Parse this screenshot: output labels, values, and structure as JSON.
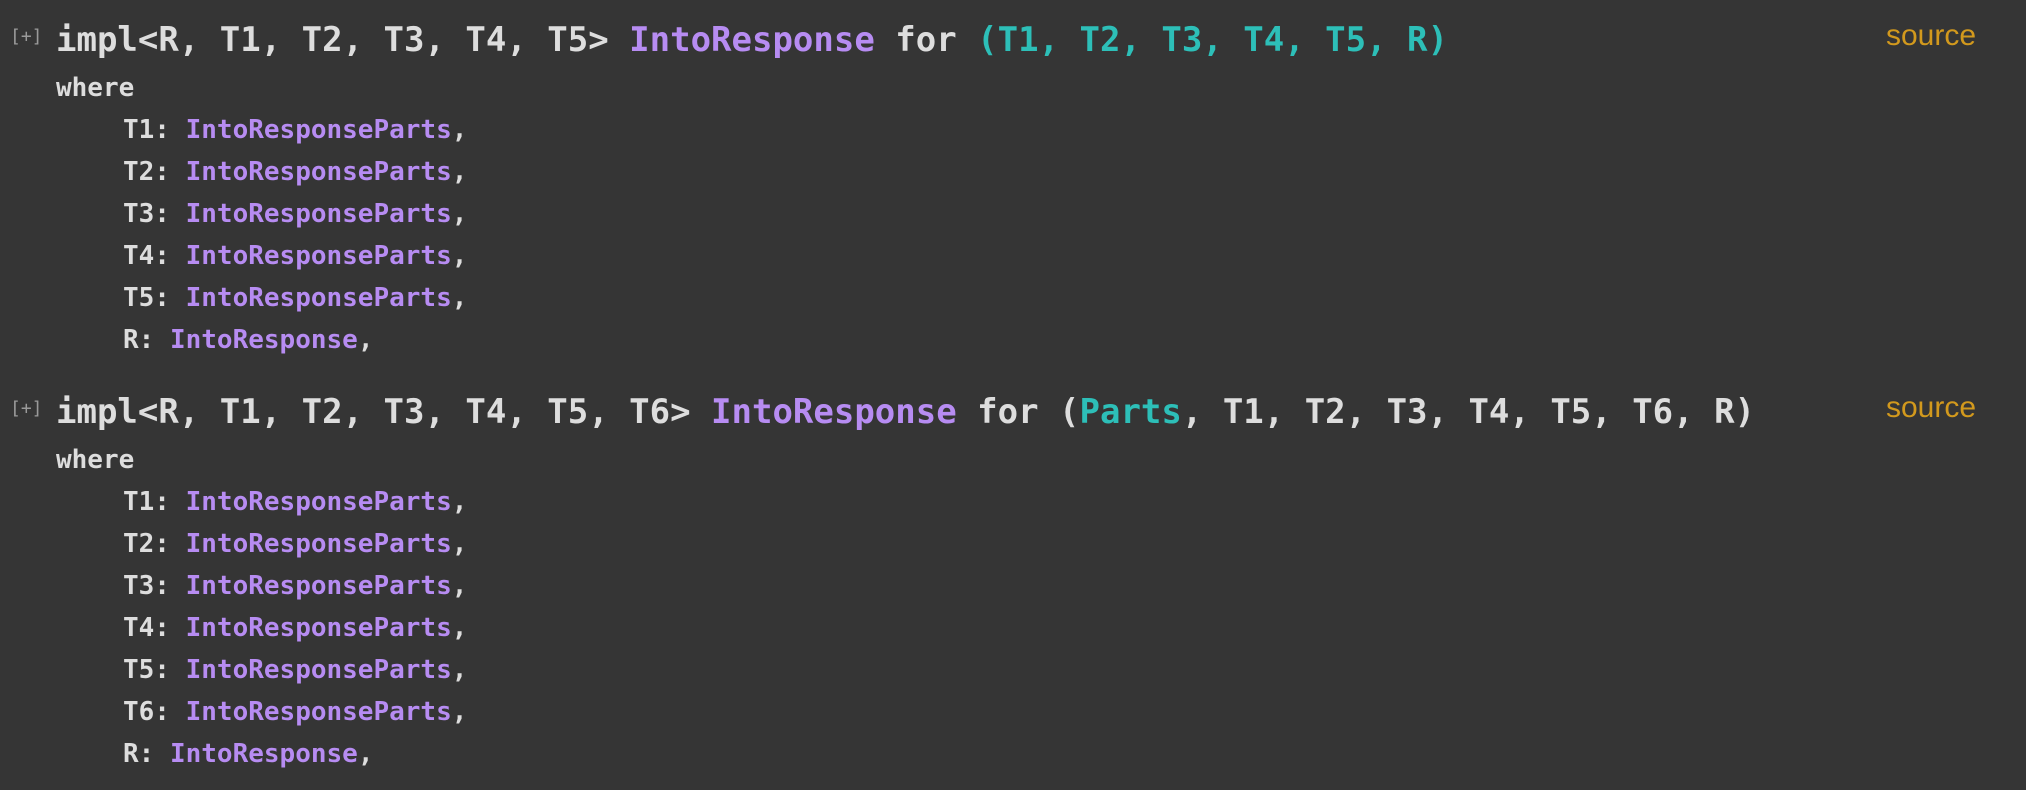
{
  "colors": {
    "background": "#353535",
    "text": "#dddddd",
    "trait": "#b78cf2",
    "type": "#2dbfb8",
    "source_link": "#d2991d"
  },
  "impls": [
    {
      "toggle": "[+]",
      "header_prefix": "impl<R, T1, T2, T3, T4, T5> ",
      "trait_name": "IntoResponse",
      "for_kw": " for ",
      "target": "(T1, T2, T3, T4, T5, R)",
      "source": "source",
      "where_kw": "where",
      "bounds": [
        {
          "param": "T1: ",
          "trait": "IntoResponseParts",
          "punct": ","
        },
        {
          "param": "T2: ",
          "trait": "IntoResponseParts",
          "punct": ","
        },
        {
          "param": "T3: ",
          "trait": "IntoResponseParts",
          "punct": ","
        },
        {
          "param": "T4: ",
          "trait": "IntoResponseParts",
          "punct": ","
        },
        {
          "param": "T5: ",
          "trait": "IntoResponseParts",
          "punct": ","
        },
        {
          "param": "R: ",
          "trait": "IntoResponse",
          "punct": ","
        }
      ]
    },
    {
      "toggle": "[+]",
      "header_prefix": "impl<R, T1, T2, T3, T4, T5, T6> ",
      "trait_name": "IntoResponse",
      "for_kw": " for ",
      "target_open": "(",
      "target_type": "Parts",
      "target_rest": ", T1, T2, T3, T4, T5, T6, R)",
      "source": "source",
      "where_kw": "where",
      "bounds": [
        {
          "param": "T1: ",
          "trait": "IntoResponseParts",
          "punct": ","
        },
        {
          "param": "T2: ",
          "trait": "IntoResponseParts",
          "punct": ","
        },
        {
          "param": "T3: ",
          "trait": "IntoResponseParts",
          "punct": ","
        },
        {
          "param": "T4: ",
          "trait": "IntoResponseParts",
          "punct": ","
        },
        {
          "param": "T5: ",
          "trait": "IntoResponseParts",
          "punct": ","
        },
        {
          "param": "T6: ",
          "trait": "IntoResponseParts",
          "punct": ","
        },
        {
          "param": "R: ",
          "trait": "IntoResponse",
          "punct": ","
        }
      ]
    }
  ]
}
